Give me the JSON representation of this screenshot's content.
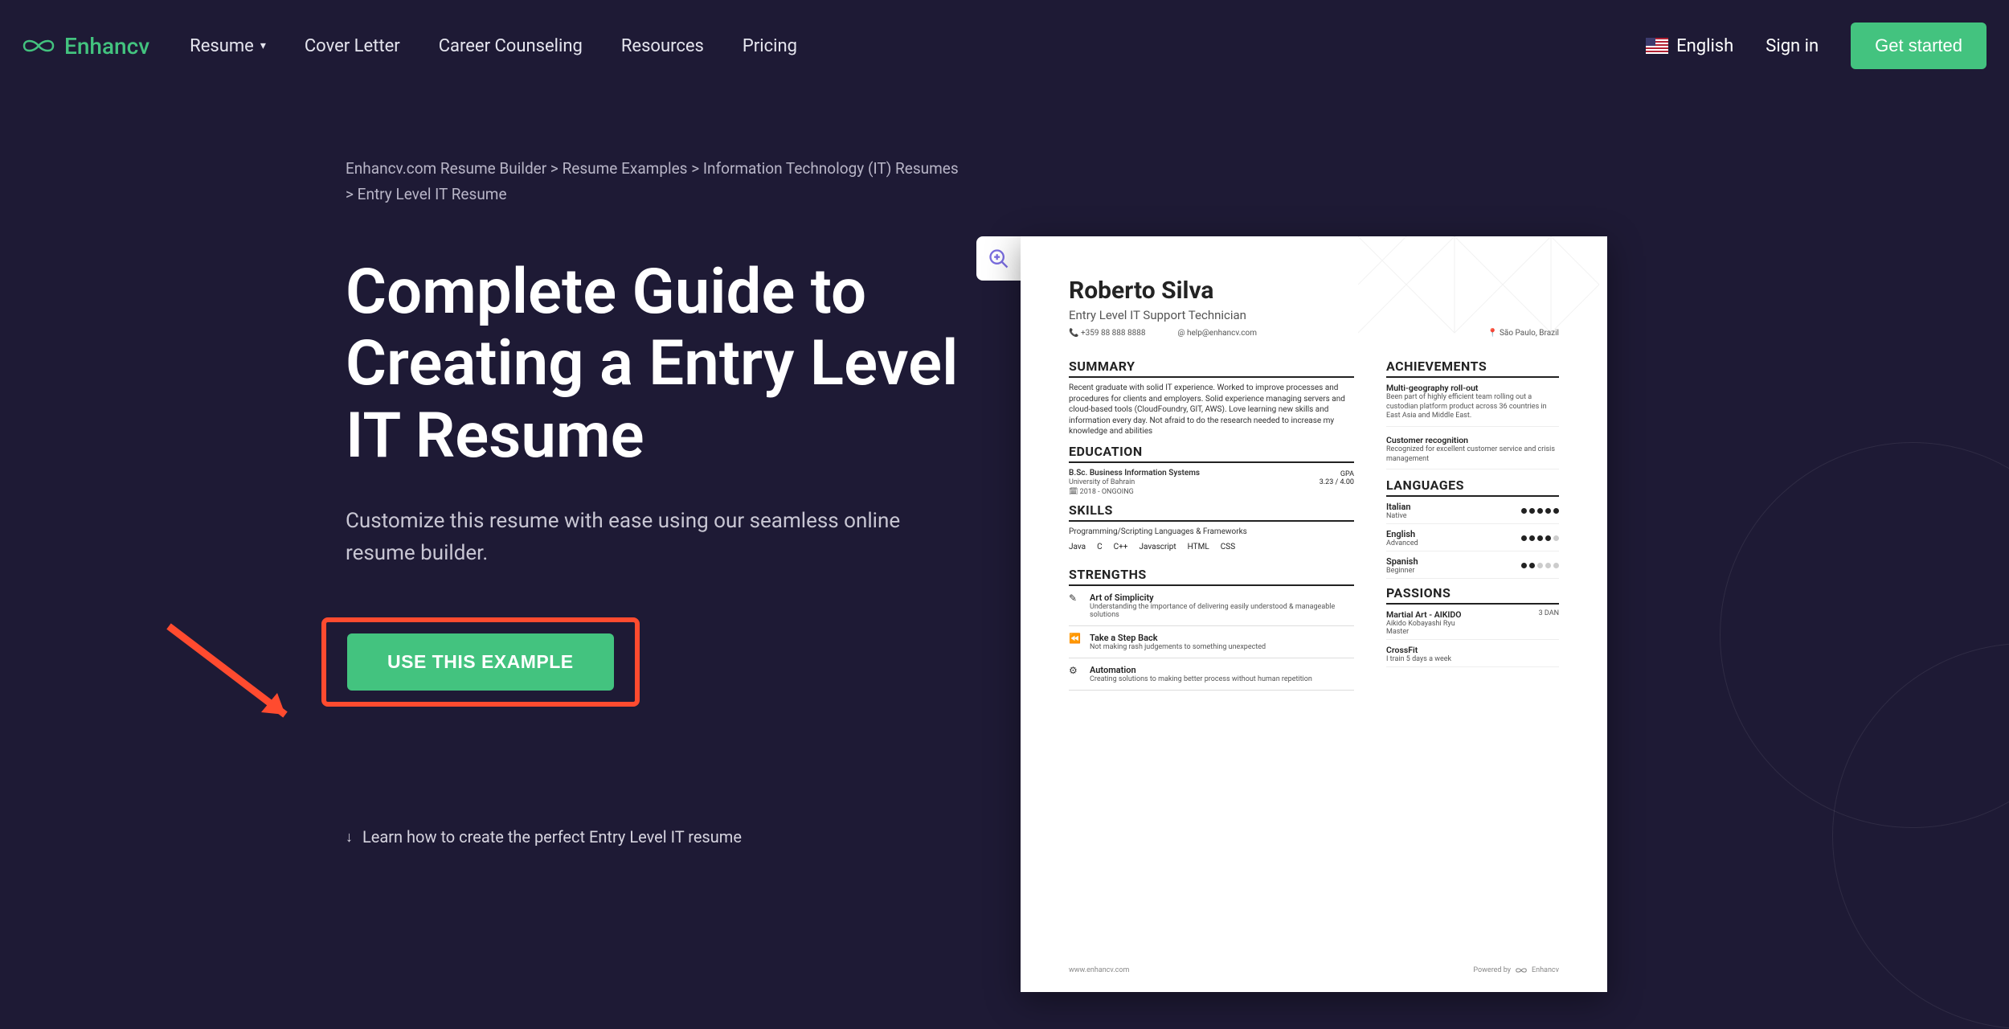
{
  "brand": "Enhancv",
  "nav": {
    "resume": "Resume",
    "cover": "Cover Letter",
    "career": "Career Counseling",
    "resources": "Resources",
    "pricing": "Pricing"
  },
  "header": {
    "language": "English",
    "signin": "Sign in",
    "cta": "Get started"
  },
  "breadcrumb": {
    "a": "Enhancv.com Resume Builder",
    "b": "Resume Examples",
    "c": "Information Technology (IT) Resumes",
    "d": "Entry Level IT Resume",
    "sep": ">"
  },
  "hero": {
    "title": "Complete Guide to Creating a Entry Level IT Resume",
    "subtitle": "Customize this resume with ease using our seamless online resume builder.",
    "button": "USE THIS EXAMPLE",
    "learn": "Learn how to create the perfect Entry Level IT resume"
  },
  "resume": {
    "name": "Roberto Silva",
    "jobtitle": "Entry Level IT Support Technician",
    "phone": "+359 88 888 8888",
    "email": "help@enhancv.com",
    "location": "São Paulo, Brazil",
    "sections": {
      "summary": "SUMMARY",
      "education": "EDUCATION",
      "skills": "SKILLS",
      "strengths": "STRENGTHS",
      "achievements": "ACHIEVEMENTS",
      "languages": "LANGUAGES",
      "passions": "PASSIONS"
    },
    "summary_text": "Recent graduate with solid IT experience. Worked to improve processes and procedures for clients and employers. Solid experience managing servers and cloud-based tools (CloudFoundry, GIT, AWS). Love learning new skills and information every day. Not afraid to do the research needed to increase my knowledge and abilities",
    "education": {
      "degree": "B.Sc. Business Information Systems",
      "school": "University of Bahrain",
      "dates": "2018 - ONGOING",
      "gpa_label": "GPA",
      "gpa": "3.23 / 4.00"
    },
    "skills_sub": "Programming/Scripting Languages & Frameworks",
    "skills_list": [
      "Java",
      "C",
      "C++",
      "Javascript",
      "HTML",
      "CSS"
    ],
    "strengths": [
      {
        "icon": "✎",
        "title": "Art of Simplicity",
        "desc": "Understanding the importance of delivering easily understood & manageable solutions"
      },
      {
        "icon": "⏪",
        "title": "Take a Step Back",
        "desc": "Not making rash judgements to something unexpected"
      },
      {
        "icon": "⚙",
        "title": "Automation",
        "desc": "Creating solutions to making better process without human repetition"
      }
    ],
    "achievements": [
      {
        "title": "Multi-geography roll-out",
        "desc": "Been part of highly efficient team rolling out a custodian platform product across 36 countries in East Asia and Middle East."
      },
      {
        "title": "Customer recognition",
        "desc": "Recognized for excellent customer service and crisis management"
      }
    ],
    "languages": [
      {
        "name": "Italian",
        "level": "Native",
        "dots": 5
      },
      {
        "name": "English",
        "level": "Advanced",
        "dots": 4
      },
      {
        "name": "Spanish",
        "level": "Beginner",
        "dots": 2
      }
    ],
    "passions": [
      {
        "title": "Martial Art - AIKIDO",
        "sub": "Aikido Kobayashi Ryu",
        "note": "Master",
        "right": "3 DAN"
      },
      {
        "title": "CrossFit",
        "sub": "I train 5 days a week",
        "note": "",
        "right": ""
      }
    ],
    "footer_site": "www.enhancv.com",
    "footer_powered": "Powered by",
    "footer_brand": "Enhancv"
  }
}
